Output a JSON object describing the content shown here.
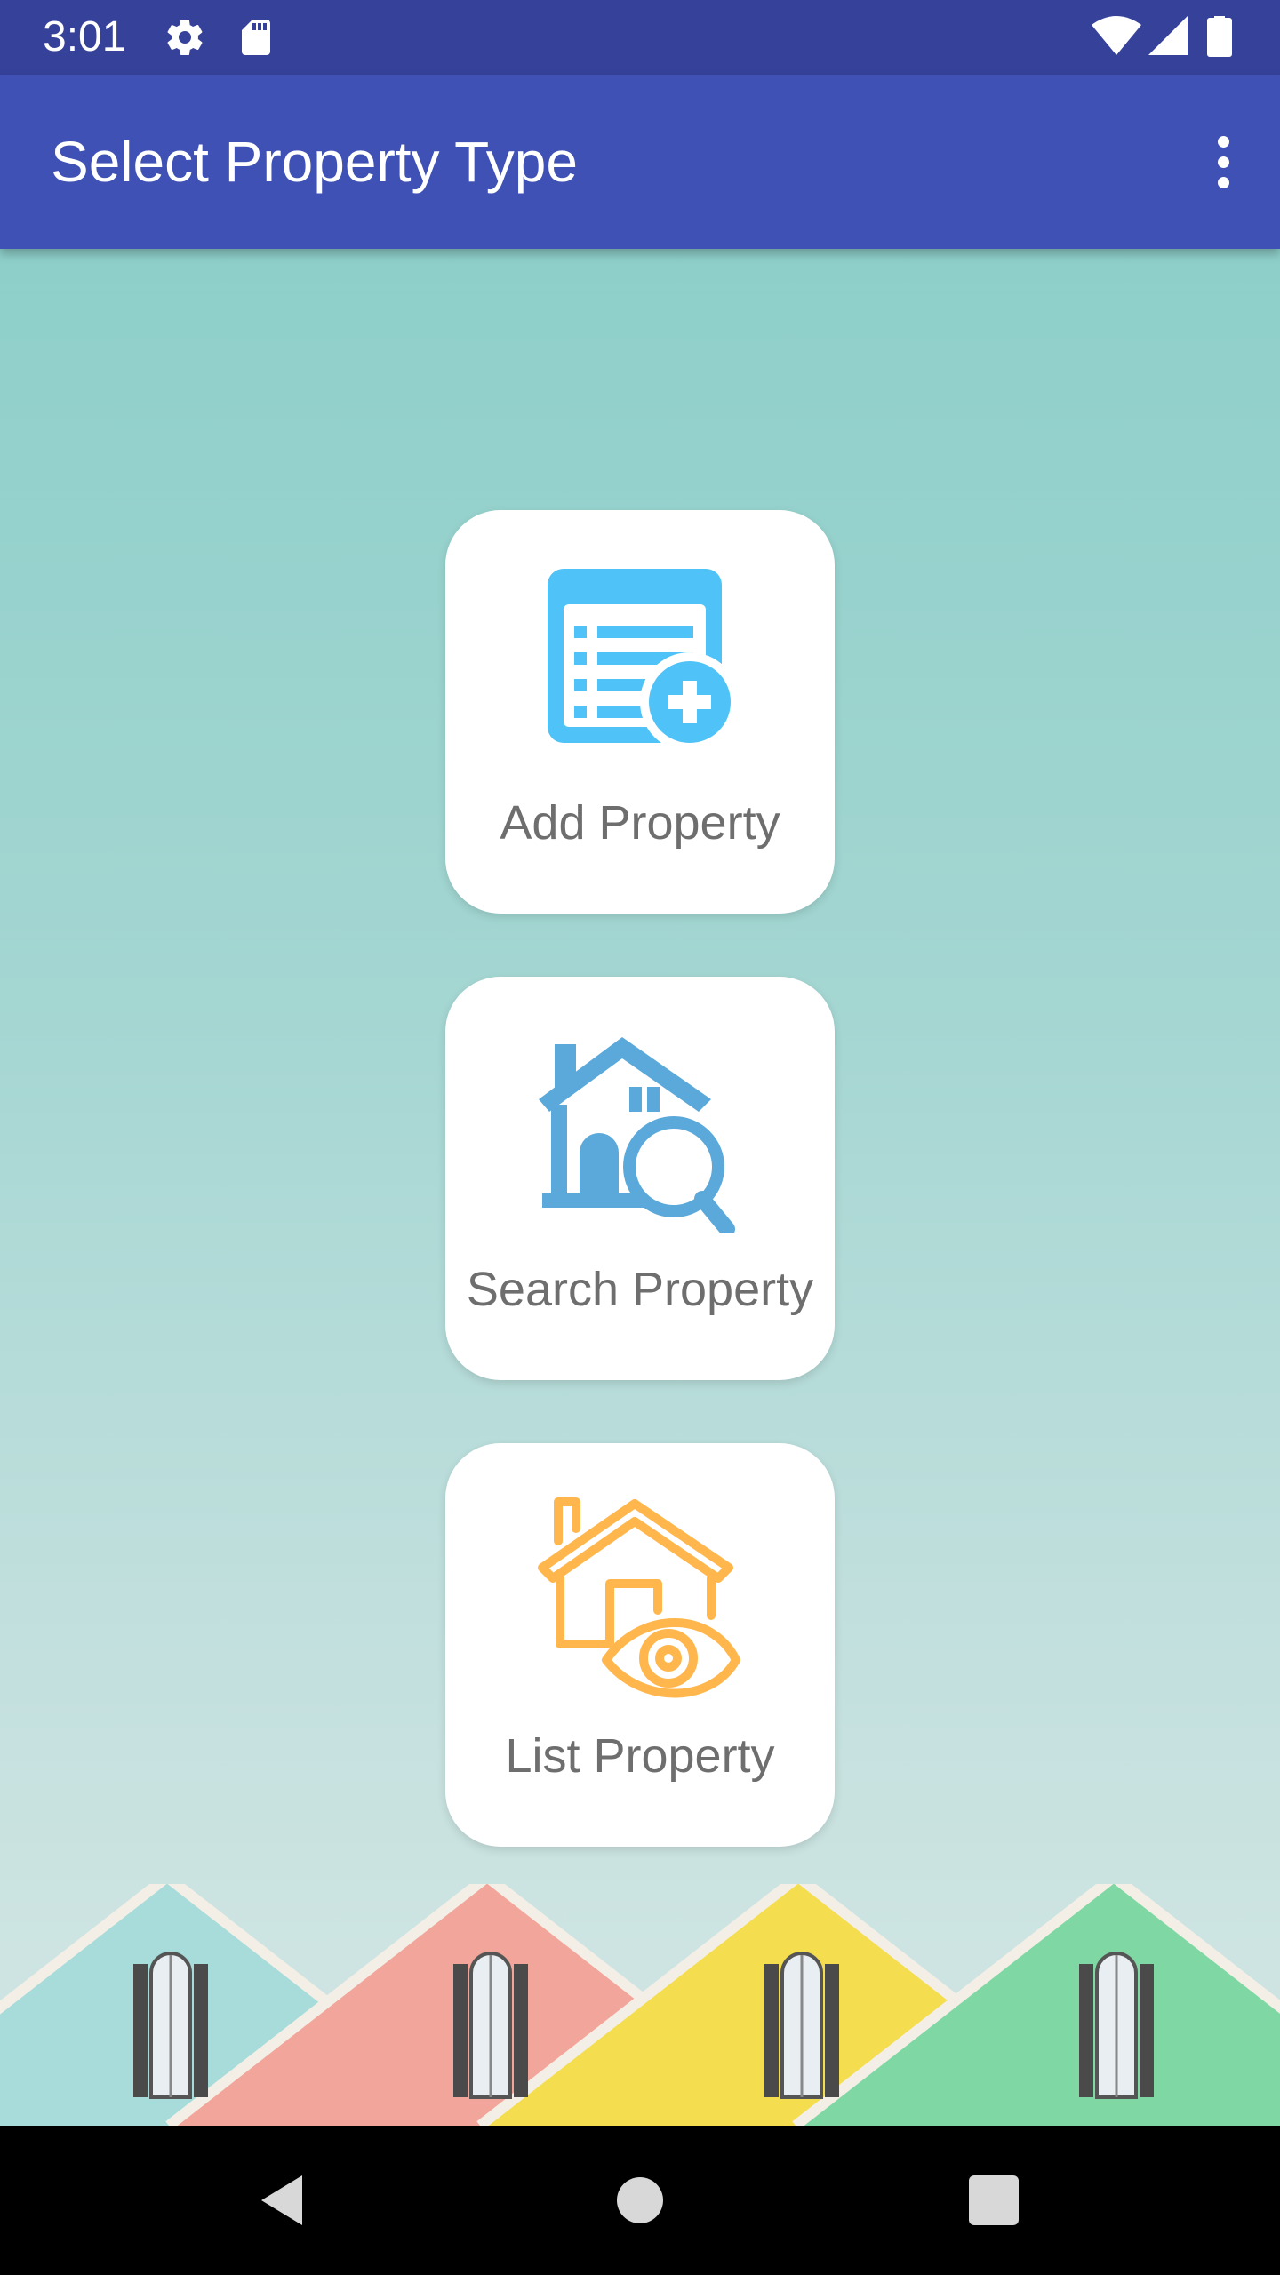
{
  "status_bar": {
    "time": "3:01",
    "icons": [
      "gear-icon",
      "sd-card-icon",
      "wifi-icon",
      "cell-signal-icon",
      "battery-icon"
    ]
  },
  "app_bar": {
    "title": "Select Property Type",
    "menu_icon": "more-vert-icon"
  },
  "cards": [
    {
      "label": "Add Property",
      "icon": "add-property-icon",
      "color": "#4FC3F7"
    },
    {
      "label": "Search Property",
      "icon": "search-property-icon",
      "color": "#5AA9DA"
    },
    {
      "label": "List Property",
      "icon": "list-property-icon",
      "color": "#FFB74D"
    }
  ],
  "background": {
    "roof_colors": [
      "#A7DCDB",
      "#F2A59A",
      "#F4DD4E",
      "#7FD8A3"
    ]
  },
  "nav_bar": {
    "buttons": [
      "back-icon",
      "home-icon",
      "recents-icon"
    ]
  }
}
